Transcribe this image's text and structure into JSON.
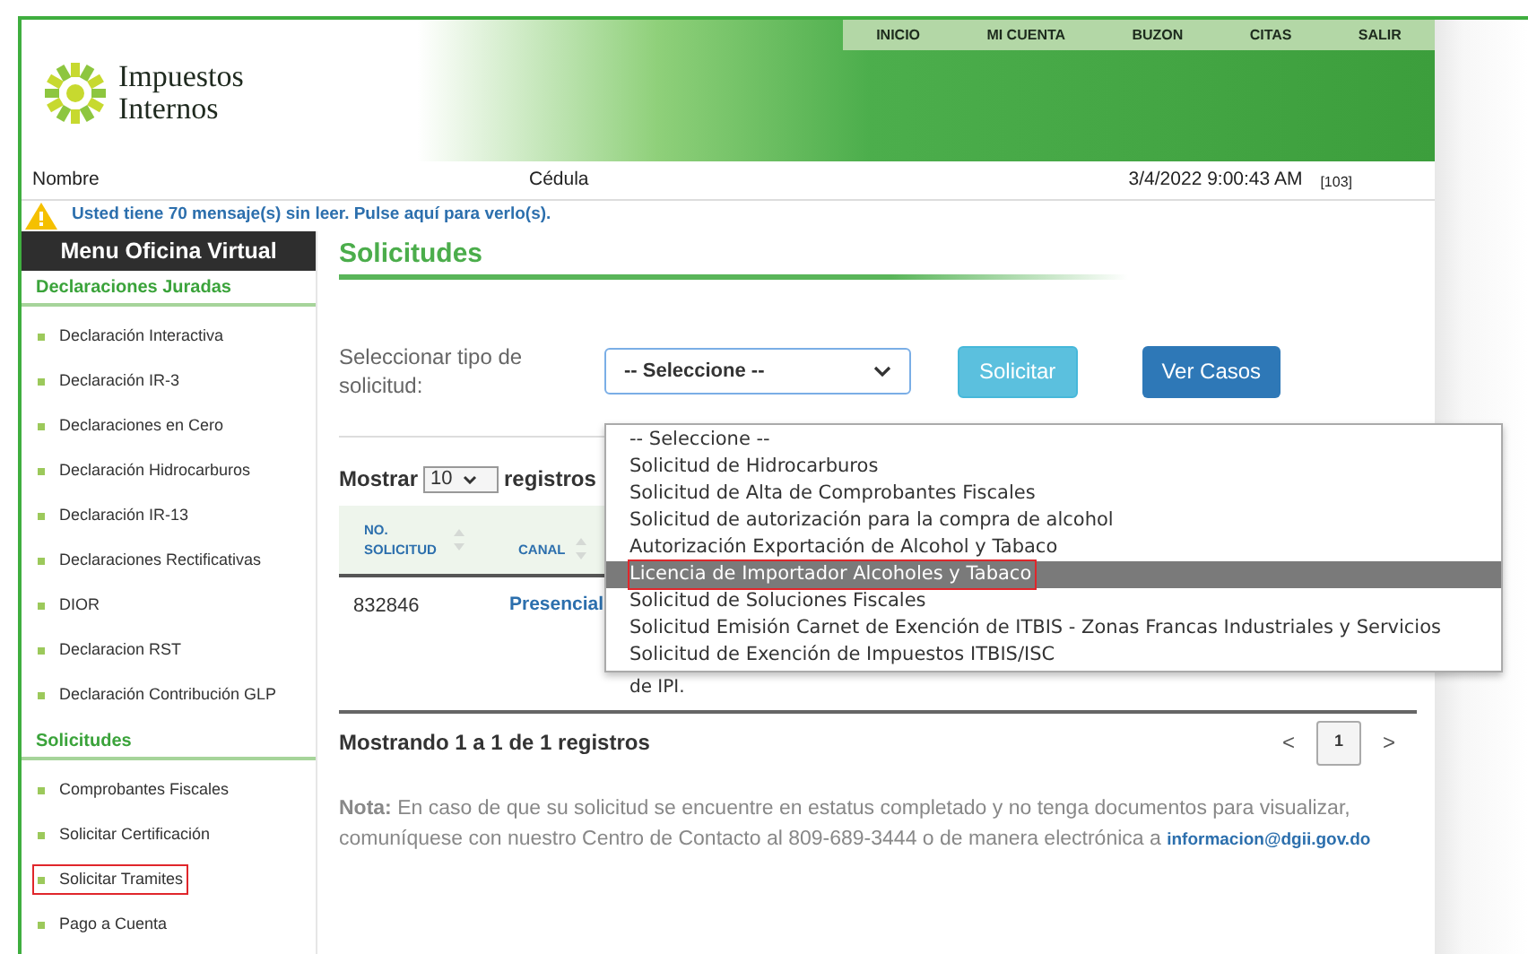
{
  "header": {
    "logo_lines": [
      "Impuestos",
      "Internos"
    ],
    "nav": [
      "INICIO",
      "MI CUENTA",
      "BUZON",
      "CITAS",
      "SALIR"
    ]
  },
  "info_bar": {
    "name_label": "Nombre",
    "id_label": "Cédula",
    "datetime": "3/4/2022 9:00:43 AM",
    "code": "[103]"
  },
  "alert": "Usted tiene 70 mensaje(s) sin leer. Pulse aquí para verlo(s).",
  "sidebar": {
    "title": "Menu Oficina Virtual",
    "sections": [
      {
        "title": "Declaraciones Juradas",
        "items": [
          {
            "label": "Declaración Interactiva",
            "outlined": false
          },
          {
            "label": "Declaración IR-3",
            "outlined": false
          },
          {
            "label": "Declaraciones en Cero",
            "outlined": false
          },
          {
            "label": "Declaración Hidrocarburos",
            "outlined": false
          },
          {
            "label": "Declaración IR-13",
            "outlined": false
          },
          {
            "label": "Declaraciones Rectificativas",
            "outlined": false
          },
          {
            "label": "DIOR",
            "outlined": false
          },
          {
            "label": "Declaracion RST",
            "outlined": false
          },
          {
            "label": "Declaración Contribución GLP",
            "outlined": false
          }
        ]
      },
      {
        "title": "Solicitudes",
        "items": [
          {
            "label": "Comprobantes Fiscales",
            "outlined": false
          },
          {
            "label": "Solicitar Certificación",
            "outlined": false
          },
          {
            "label": "Solicitar Tramites",
            "outlined": true
          },
          {
            "label": "Pago a Cuenta",
            "outlined": false
          }
        ]
      }
    ]
  },
  "page_title": "Solicitudes",
  "form": {
    "label": "Seleccionar tipo de solicitud:",
    "select_value": "-- Seleccione --",
    "buttons": [
      "Solicitar",
      "Ver Casos"
    ]
  },
  "dropdown": {
    "options": [
      {
        "label": "-- Seleccione --",
        "selected": false,
        "outlined": false
      },
      {
        "label": "Solicitud de Hidrocarburos",
        "selected": false,
        "outlined": false
      },
      {
        "label": "Solicitud de Alta de Comprobantes Fiscales",
        "selected": false,
        "outlined": false
      },
      {
        "label": "Solicitud de autorización para la compra de alcohol",
        "selected": false,
        "outlined": false
      },
      {
        "label": "Autorización Exportación de Alcohol y Tabaco",
        "selected": false,
        "outlined": false
      },
      {
        "label": "Licencia de Importador Alcoholes y Tabaco",
        "selected": true,
        "outlined": true
      },
      {
        "label": "Solicitud de Soluciones Fiscales",
        "selected": false,
        "outlined": false
      },
      {
        "label": "Solicitud Emisión Carnet de Exención de ITBIS - Zonas Francas Industriales y Servicios",
        "selected": false,
        "outlined": false
      },
      {
        "label": "Solicitud de Exención de Impuestos ITBIS/ISC",
        "selected": false,
        "outlined": false
      }
    ]
  },
  "table": {
    "show_prefix": "Mostrar",
    "page_size": "10",
    "show_suffix": "registros",
    "columns": [
      "NO. SOLICITUD",
      "CANAL"
    ],
    "rows": [
      {
        "cells": [
          "832846",
          "Presencial",
          "de IPI."
        ]
      }
    ],
    "summary": "Mostrando 1 a 1 de 1 registros",
    "pagination": {
      "prev": "<",
      "page": "1",
      "next": ">"
    }
  },
  "note": {
    "label": "Nota:",
    "text": "En caso de que su solicitud se encuentre en estatus completado y no tenga documentos para visualizar, comuníquese con nuestro Centro de Contacto al 809-689-3444 o de manera electrónica a",
    "email": "informacion@dgii.gov.do"
  }
}
